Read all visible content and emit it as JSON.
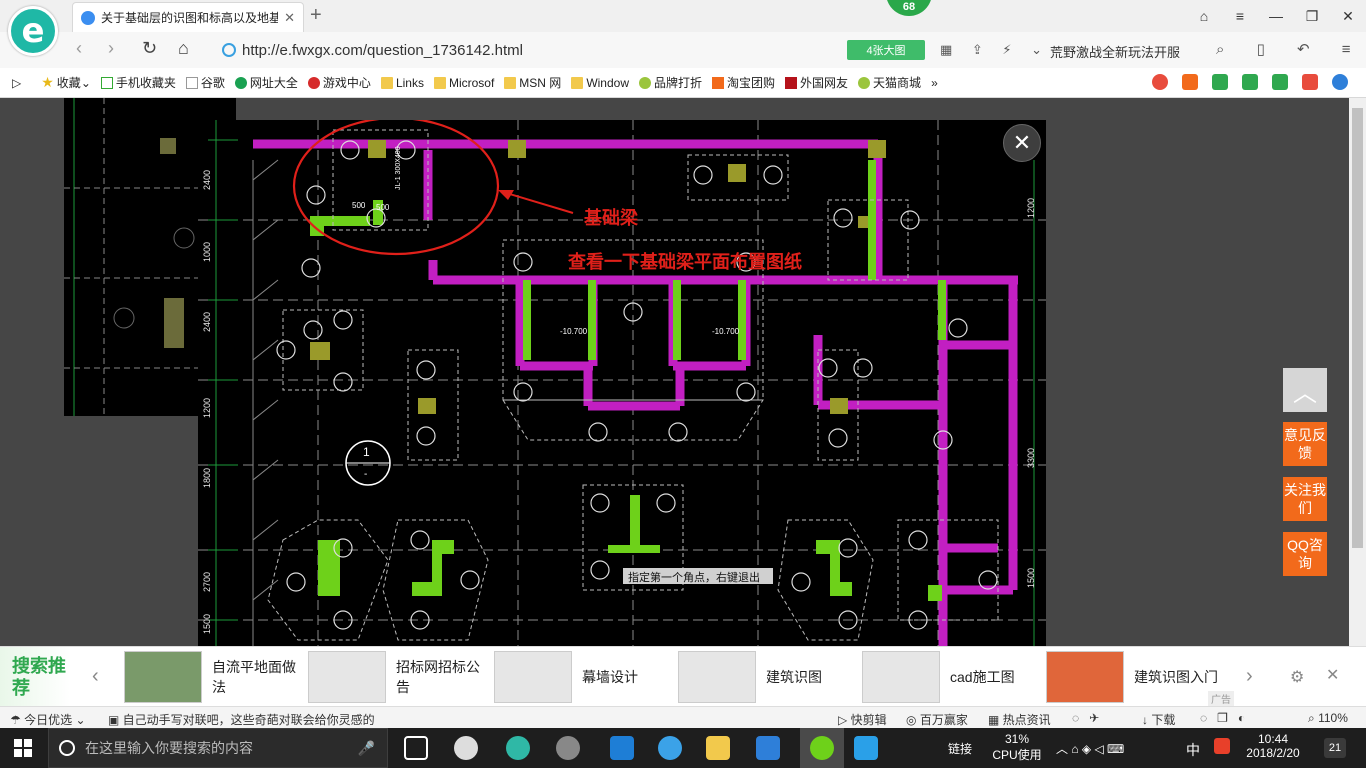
{
  "browser": {
    "tab_title": "关于基础层的识图和标高以及地基",
    "badge_count": "68",
    "url": "http://e.fwxgx.com/question_1736142.html",
    "big_pic_label": "4张大图",
    "promo_text": "荒野激战全新玩法开服",
    "bookmarks": [
      "收藏",
      "手机收藏夹",
      "谷歌",
      "网址大全",
      "游戏中心",
      "Links",
      "Microsof",
      "MSN 网",
      "Window",
      "品牌打折",
      "淘宝团购",
      "外国网友",
      "天猫商城"
    ]
  },
  "viewer": {
    "annotation_label": "基础梁",
    "annotation_note": "查看一下基础梁平面布置图纸",
    "cad_prompt": "指定第一个角点，右键退出",
    "section_mark": "1",
    "section_sub": "-",
    "dim_500_a": "500",
    "dim_500_b": "500",
    "beam_tag": "JL-1 300X400",
    "elev_a": "-10.700",
    "elev_b": "-10.700",
    "left_dims": [
      "2400",
      "1000",
      "2400",
      "1200",
      "1800",
      "2700",
      "1500",
      "100"
    ],
    "right_dims": [
      "1200",
      "3300",
      "1500"
    ]
  },
  "side": {
    "feedback": "意见反馈",
    "follow": "关注我们",
    "qq": "QQ咨询"
  },
  "recs": {
    "label": "搜索推荐",
    "items": [
      "自流平地面做法",
      "招标网招标公告",
      "幕墙设计",
      "建筑识图",
      "cad施工图",
      "建筑识图入门"
    ],
    "ad": "广告"
  },
  "status": {
    "today": "今日优选",
    "headline": "自己动手写对联吧，这些奇葩对联会给你灵感的",
    "quick_cut": "快剪辑",
    "millionaire": "百万赢家",
    "hot_news": "热点资讯",
    "download": "下载",
    "zoom": "110%"
  },
  "taskbar": {
    "search_placeholder": "在这里输入你要搜索的内容",
    "link_label": "链接",
    "cpu_percent": "31%",
    "cpu_label": "CPU使用",
    "ime": "中",
    "time": "10:44",
    "date": "2018/2/20",
    "notif_count": "21"
  }
}
